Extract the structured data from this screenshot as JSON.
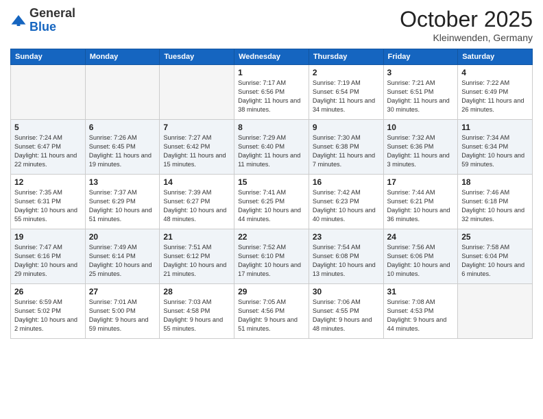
{
  "logo": {
    "general": "General",
    "blue": "Blue"
  },
  "header": {
    "month": "October 2025",
    "location": "Kleinwenden, Germany"
  },
  "weekdays": [
    "Sunday",
    "Monday",
    "Tuesday",
    "Wednesday",
    "Thursday",
    "Friday",
    "Saturday"
  ],
  "weeks": [
    [
      {
        "day": "",
        "sunrise": "",
        "sunset": "",
        "daylight": ""
      },
      {
        "day": "",
        "sunrise": "",
        "sunset": "",
        "daylight": ""
      },
      {
        "day": "",
        "sunrise": "",
        "sunset": "",
        "daylight": ""
      },
      {
        "day": "1",
        "sunrise": "7:17 AM",
        "sunset": "6:56 PM",
        "daylight": "11 hours and 38 minutes."
      },
      {
        "day": "2",
        "sunrise": "7:19 AM",
        "sunset": "6:54 PM",
        "daylight": "11 hours and 34 minutes."
      },
      {
        "day": "3",
        "sunrise": "7:21 AM",
        "sunset": "6:51 PM",
        "daylight": "11 hours and 30 minutes."
      },
      {
        "day": "4",
        "sunrise": "7:22 AM",
        "sunset": "6:49 PM",
        "daylight": "11 hours and 26 minutes."
      }
    ],
    [
      {
        "day": "5",
        "sunrise": "7:24 AM",
        "sunset": "6:47 PM",
        "daylight": "11 hours and 22 minutes."
      },
      {
        "day": "6",
        "sunrise": "7:26 AM",
        "sunset": "6:45 PM",
        "daylight": "11 hours and 19 minutes."
      },
      {
        "day": "7",
        "sunrise": "7:27 AM",
        "sunset": "6:42 PM",
        "daylight": "11 hours and 15 minutes."
      },
      {
        "day": "8",
        "sunrise": "7:29 AM",
        "sunset": "6:40 PM",
        "daylight": "11 hours and 11 minutes."
      },
      {
        "day": "9",
        "sunrise": "7:30 AM",
        "sunset": "6:38 PM",
        "daylight": "11 hours and 7 minutes."
      },
      {
        "day": "10",
        "sunrise": "7:32 AM",
        "sunset": "6:36 PM",
        "daylight": "11 hours and 3 minutes."
      },
      {
        "day": "11",
        "sunrise": "7:34 AM",
        "sunset": "6:34 PM",
        "daylight": "10 hours and 59 minutes."
      }
    ],
    [
      {
        "day": "12",
        "sunrise": "7:35 AM",
        "sunset": "6:31 PM",
        "daylight": "10 hours and 55 minutes."
      },
      {
        "day": "13",
        "sunrise": "7:37 AM",
        "sunset": "6:29 PM",
        "daylight": "10 hours and 51 minutes."
      },
      {
        "day": "14",
        "sunrise": "7:39 AM",
        "sunset": "6:27 PM",
        "daylight": "10 hours and 48 minutes."
      },
      {
        "day": "15",
        "sunrise": "7:41 AM",
        "sunset": "6:25 PM",
        "daylight": "10 hours and 44 minutes."
      },
      {
        "day": "16",
        "sunrise": "7:42 AM",
        "sunset": "6:23 PM",
        "daylight": "10 hours and 40 minutes."
      },
      {
        "day": "17",
        "sunrise": "7:44 AM",
        "sunset": "6:21 PM",
        "daylight": "10 hours and 36 minutes."
      },
      {
        "day": "18",
        "sunrise": "7:46 AM",
        "sunset": "6:18 PM",
        "daylight": "10 hours and 32 minutes."
      }
    ],
    [
      {
        "day": "19",
        "sunrise": "7:47 AM",
        "sunset": "6:16 PM",
        "daylight": "10 hours and 29 minutes."
      },
      {
        "day": "20",
        "sunrise": "7:49 AM",
        "sunset": "6:14 PM",
        "daylight": "10 hours and 25 minutes."
      },
      {
        "day": "21",
        "sunrise": "7:51 AM",
        "sunset": "6:12 PM",
        "daylight": "10 hours and 21 minutes."
      },
      {
        "day": "22",
        "sunrise": "7:52 AM",
        "sunset": "6:10 PM",
        "daylight": "10 hours and 17 minutes."
      },
      {
        "day": "23",
        "sunrise": "7:54 AM",
        "sunset": "6:08 PM",
        "daylight": "10 hours and 13 minutes."
      },
      {
        "day": "24",
        "sunrise": "7:56 AM",
        "sunset": "6:06 PM",
        "daylight": "10 hours and 10 minutes."
      },
      {
        "day": "25",
        "sunrise": "7:58 AM",
        "sunset": "6:04 PM",
        "daylight": "10 hours and 6 minutes."
      }
    ],
    [
      {
        "day": "26",
        "sunrise": "6:59 AM",
        "sunset": "5:02 PM",
        "daylight": "10 hours and 2 minutes."
      },
      {
        "day": "27",
        "sunrise": "7:01 AM",
        "sunset": "5:00 PM",
        "daylight": "9 hours and 59 minutes."
      },
      {
        "day": "28",
        "sunrise": "7:03 AM",
        "sunset": "4:58 PM",
        "daylight": "9 hours and 55 minutes."
      },
      {
        "day": "29",
        "sunrise": "7:05 AM",
        "sunset": "4:56 PM",
        "daylight": "9 hours and 51 minutes."
      },
      {
        "day": "30",
        "sunrise": "7:06 AM",
        "sunset": "4:55 PM",
        "daylight": "9 hours and 48 minutes."
      },
      {
        "day": "31",
        "sunrise": "7:08 AM",
        "sunset": "4:53 PM",
        "daylight": "9 hours and 44 minutes."
      },
      {
        "day": "",
        "sunrise": "",
        "sunset": "",
        "daylight": ""
      }
    ]
  ],
  "labels": {
    "sunrise_prefix": "Sunrise: ",
    "sunset_prefix": "Sunset: ",
    "daylight_prefix": "Daylight: "
  }
}
